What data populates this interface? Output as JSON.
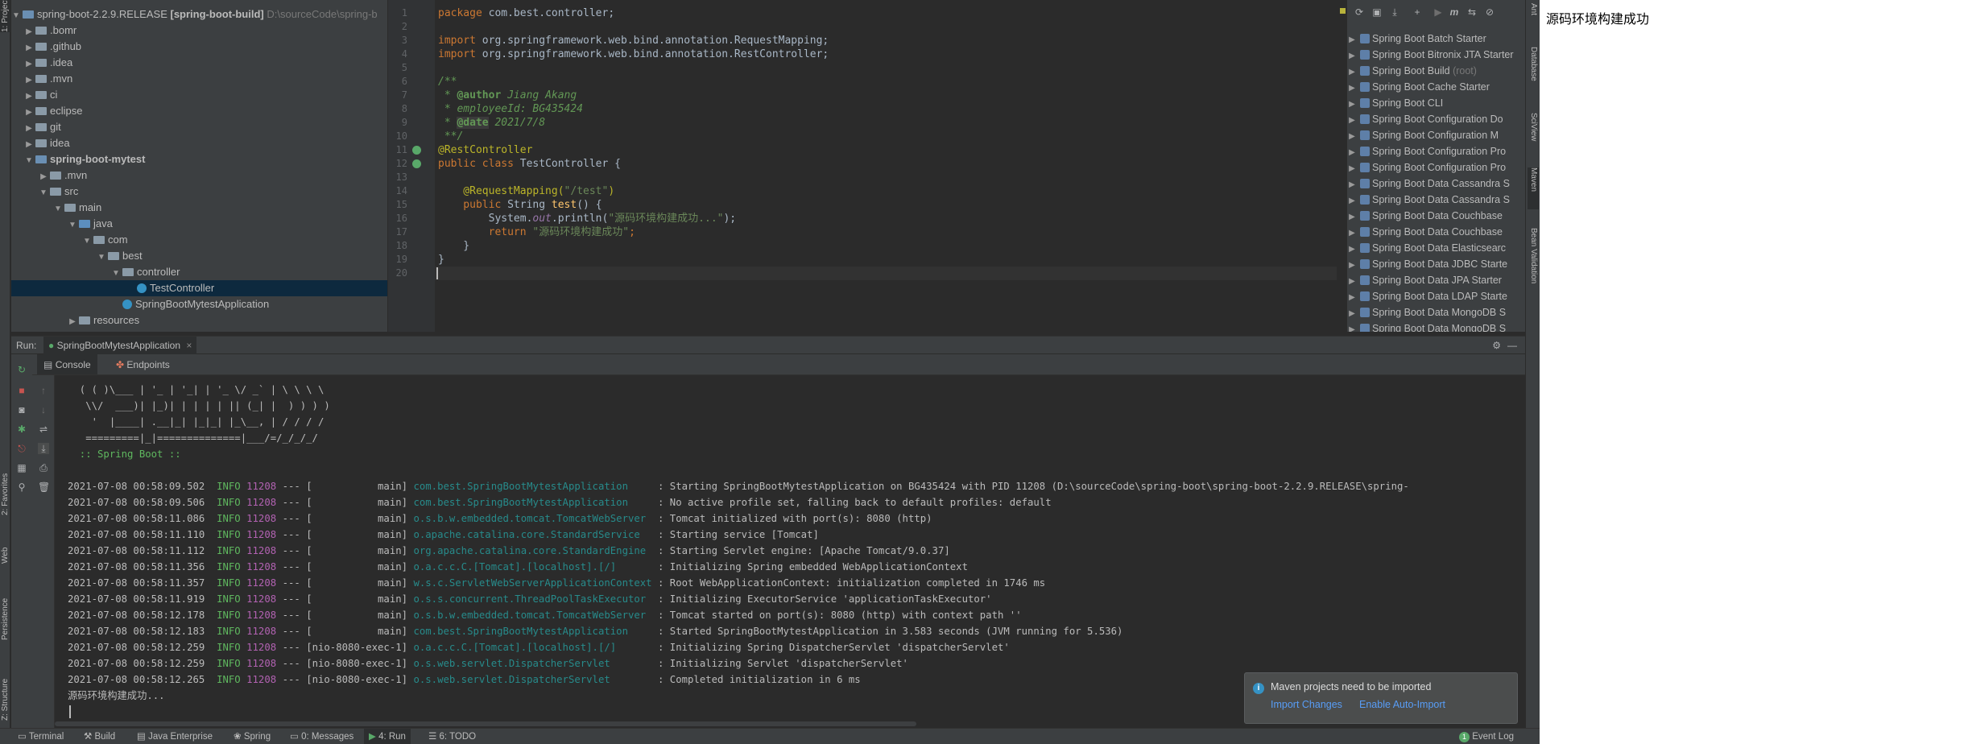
{
  "project": {
    "root": "spring-boot-2.2.9.RELEASE",
    "root_module": "[spring-boot-build]",
    "root_path": "D:\\sourceCode\\spring-b",
    "items": [
      ".bomr",
      ".github",
      ".idea",
      ".mvn",
      "ci",
      "eclipse",
      "git",
      "idea",
      "spring-boot-mytest",
      ".mvn",
      "src",
      "main",
      "java",
      "com",
      "best",
      "controller",
      "TestController",
      "SpringBootMytestApplication",
      "resources"
    ]
  },
  "left_tabs": {
    "project": "1: Project",
    "favorites": "2: Favorites",
    "web": "Web",
    "persistence": "Persistence",
    "structure": "Z: Structure"
  },
  "editor": {
    "line_numbers": [
      "1",
      "2",
      "3",
      "4",
      "5",
      "6",
      "7",
      "8",
      "9",
      "10",
      "11",
      "12",
      "13",
      "14",
      "15",
      "16",
      "17",
      "18",
      "19",
      "20"
    ],
    "l1_kw": "package",
    "l1_rest": " com.best.controller;",
    "l3_kw": "import",
    "l3_rest": " org.springframework.web.bind.annotation.RequestMapping;",
    "l4_kw": "import",
    "l4_rest": " org.springframework.web.bind.annotation.RestController;",
    "l6": "/**",
    "l7_pre": " * ",
    "l7_tag": "@author",
    "l7_val": " Jiang Akang",
    "l8": " * employeeId: BG435424",
    "l9_pre": " * ",
    "l9_tag": "@date",
    "l9_val": " 2021/7/8",
    "l10": " **/",
    "l11": "@RestController",
    "l12_kw1": "public",
    "l12_kw2": " class",
    "l12_rest": " TestController {",
    "l15_ann": "    @RequestMapping(",
    "l15_str": "\"/test\"",
    "l15_end": ")",
    "l16_kw1": "    public",
    "l16_rest": " String ",
    "l16_fn": "test",
    "l16_end": "() {",
    "l17_pre": "        System.",
    "l17_fld": "out",
    "l17_mid": ".println(",
    "l17_str": "\"源码环境构建成功...\"",
    "l17_end": ");",
    "l18_kw": "        return",
    "l18_str": " \"源码环境构建成功\"",
    "l18_end": ";",
    "l19": "    }",
    "l20": "}"
  },
  "maven": {
    "items": [
      "Spring Boot Batch Starter",
      "Spring Boot Bitronix JTA Starter",
      "Spring Boot Build",
      "Spring Boot Cache Starter",
      "Spring Boot CLI",
      "Spring Boot Configuration Do",
      "Spring Boot Configuration M",
      "Spring Boot Configuration Pro",
      "Spring Boot Configuration Pro",
      "Spring Boot Data Cassandra S",
      "Spring Boot Data Cassandra S",
      "Spring Boot Data Couchbase",
      "Spring Boot Data Couchbase",
      "Spring Boot Data Elasticsearc",
      "Spring Boot Data JDBC Starte",
      "Spring Boot Data JPA Starter",
      "Spring Boot Data LDAP Starte",
      "Spring Boot Data MongoDB S",
      "Spring Boot Data MongoDB S"
    ],
    "root_suffix": "(root)"
  },
  "right_tabs": {
    "ant": "Ant",
    "database": "Database",
    "sciview": "SciView",
    "maven": "Maven",
    "bean_validation": "Bean Validation"
  },
  "run": {
    "label": "Run:",
    "config": "SpringBootMytestApplication",
    "tab_console": "Console",
    "tab_endpoints": "Endpoints"
  },
  "console": {
    "banner": [
      "  ( ( )\\___ | '_ | '_| | '_ \\/ _` | \\ \\ \\ \\",
      "   \\\\/  ___)| |_)| | | | | || (_| |  ) ) ) )",
      "    '  |____| .__|_| |_|_| |_\\__, | / / / /",
      "   =========|_|==============|___/=/_/_/_/"
    ],
    "spring_boot": "  :: Spring Boot ::",
    "logs": [
      {
        "ts": "2021-07-08 00:58:09.502",
        "level": "INFO",
        "pid": "11208",
        "sep": "---",
        "thread": "[           main]",
        "logger": "com.best.SpringBootMytestApplication    ",
        "msg": " : Starting SpringBootMytestApplication on BG435424 with PID 11208 (D:\\sourceCode\\spring-boot\\spring-boot-2.2.9.RELEASE\\spring-"
      },
      {
        "ts": "2021-07-08 00:58:09.506",
        "level": "INFO",
        "pid": "11208",
        "sep": "---",
        "thread": "[           main]",
        "logger": "com.best.SpringBootMytestApplication    ",
        "msg": " : No active profile set, falling back to default profiles: default"
      },
      {
        "ts": "2021-07-08 00:58:11.086",
        "level": "INFO",
        "pid": "11208",
        "sep": "---",
        "thread": "[           main]",
        "logger": "o.s.b.w.embedded.tomcat.TomcatWebServer ",
        "msg": " : Tomcat initialized with port(s): 8080 (http)"
      },
      {
        "ts": "2021-07-08 00:58:11.110",
        "level": "INFO",
        "pid": "11208",
        "sep": "---",
        "thread": "[           main]",
        "logger": "o.apache.catalina.core.StandardService  ",
        "msg": " : Starting service [Tomcat]"
      },
      {
        "ts": "2021-07-08 00:58:11.112",
        "level": "INFO",
        "pid": "11208",
        "sep": "---",
        "thread": "[           main]",
        "logger": "org.apache.catalina.core.StandardEngine ",
        "msg": " : Starting Servlet engine: [Apache Tomcat/9.0.37]"
      },
      {
        "ts": "2021-07-08 00:58:11.356",
        "level": "INFO",
        "pid": "11208",
        "sep": "---",
        "thread": "[           main]",
        "logger": "o.a.c.c.C.[Tomcat].[localhost].[/]      ",
        "msg": " : Initializing Spring embedded WebApplicationContext"
      },
      {
        "ts": "2021-07-08 00:58:11.357",
        "level": "INFO",
        "pid": "11208",
        "sep": "---",
        "thread": "[           main]",
        "logger": "w.s.c.ServletWebServerApplicationContext",
        "msg": " : Root WebApplicationContext: initialization completed in 1746 ms"
      },
      {
        "ts": "2021-07-08 00:58:11.919",
        "level": "INFO",
        "pid": "11208",
        "sep": "---",
        "thread": "[           main]",
        "logger": "o.s.s.concurrent.ThreadPoolTaskExecutor ",
        "msg": " : Initializing ExecutorService 'applicationTaskExecutor'"
      },
      {
        "ts": "2021-07-08 00:58:12.178",
        "level": "INFO",
        "pid": "11208",
        "sep": "---",
        "thread": "[           main]",
        "logger": "o.s.b.w.embedded.tomcat.TomcatWebServer ",
        "msg": " : Tomcat started on port(s): 8080 (http) with context path ''"
      },
      {
        "ts": "2021-07-08 00:58:12.183",
        "level": "INFO",
        "pid": "11208",
        "sep": "---",
        "thread": "[           main]",
        "logger": "com.best.SpringBootMytestApplication    ",
        "msg": " : Started SpringBootMytestApplication in 3.583 seconds (JVM running for 5.536)"
      },
      {
        "ts": "2021-07-08 00:58:12.259",
        "level": "INFO",
        "pid": "11208",
        "sep": "---",
        "thread": "[nio-8080-exec-1]",
        "logger": "o.a.c.c.C.[Tomcat].[localhost].[/]      ",
        "msg": " : Initializing Spring DispatcherServlet 'dispatcherServlet'"
      },
      {
        "ts": "2021-07-08 00:58:12.259",
        "level": "INFO",
        "pid": "11208",
        "sep": "---",
        "thread": "[nio-8080-exec-1]",
        "logger": "o.s.web.servlet.DispatcherServlet       ",
        "msg": " : Initializing Servlet 'dispatcherServlet'"
      },
      {
        "ts": "2021-07-08 00:58:12.265",
        "level": "INFO",
        "pid": "11208",
        "sep": "---",
        "thread": "[nio-8080-exec-1]",
        "logger": "o.s.web.servlet.DispatcherServlet       ",
        "msg": " : Completed initialization in 6 ms"
      }
    ],
    "output": "源码环境构建成功..."
  },
  "notification": {
    "title": "Maven projects need to be imported",
    "action1": "Import Changes",
    "action2": "Enable Auto-Import"
  },
  "statusbar": {
    "terminal": "Terminal",
    "build": "Build",
    "java_enterprise": "Java Enterprise",
    "spring": "Spring",
    "messages": "0: Messages",
    "run": "4: Run",
    "todo": "6: TODO",
    "event_log": "Event Log",
    "event_badge": "1"
  },
  "browser": {
    "response": "源码环境构建成功"
  },
  "colors": {
    "ide_bg": "#2b2b2b",
    "panel_bg": "#3c3f41",
    "keyword": "#cc7832",
    "string": "#6a8759",
    "annotation": "#bbb529",
    "info": "#5fb85f",
    "link": "#589df6"
  }
}
